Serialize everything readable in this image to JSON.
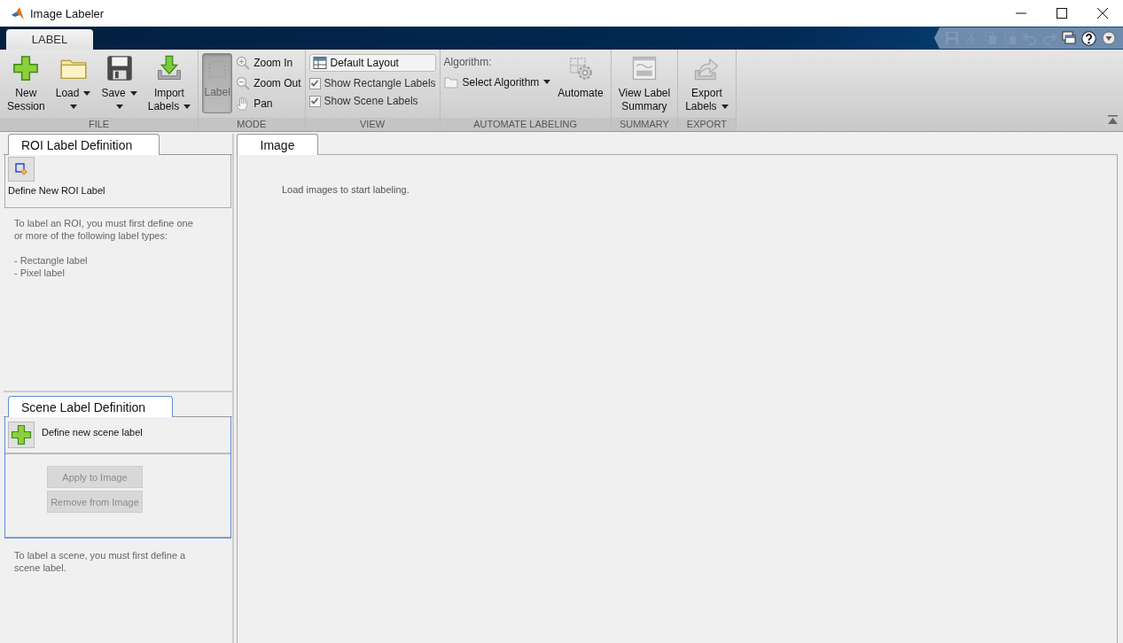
{
  "window": {
    "title": "Image Labeler"
  },
  "ribbon_tabs": [
    {
      "label": "LABEL",
      "selected": true
    }
  ],
  "quick_access": [
    {
      "kind": "save",
      "disabled": true
    },
    {
      "kind": "cut",
      "disabled": true
    },
    {
      "kind": "copy",
      "disabled": true
    },
    {
      "kind": "paste",
      "disabled": true
    },
    {
      "kind": "undo",
      "disabled": true
    },
    {
      "kind": "redo",
      "disabled": true
    },
    {
      "kind": "windows",
      "disabled": false
    },
    {
      "kind": "help",
      "disabled": false
    },
    {
      "kind": "more",
      "disabled": false
    }
  ],
  "sections": [
    {
      "title": "FILE",
      "columns": [
        [
          {
            "kind": "big",
            "lines": [
              "New",
              "Session"
            ],
            "dropdown": false
          }
        ],
        [
          {
            "kind": "big",
            "lines": [
              "Load"
            ],
            "dropdown": true
          }
        ],
        [
          {
            "kind": "big",
            "lines": [
              "Save"
            ],
            "dropdown": true
          }
        ],
        [
          {
            "kind": "big",
            "lines": [
              "Import",
              "Labels"
            ],
            "dropdown": true
          }
        ]
      ]
    },
    {
      "title": "MODE",
      "columns": [
        [
          {
            "kind": "toggle",
            "lines": [
              "Label"
            ],
            "selected": true
          }
        ],
        [
          {
            "kind": "small",
            "label": "Zoom In"
          },
          {
            "kind": "small",
            "label": "Zoom Out"
          },
          {
            "kind": "small",
            "label": "Pan"
          }
        ]
      ]
    },
    {
      "title": "VIEW",
      "columns": [
        [
          {
            "kind": "layout",
            "label": "Default Layout"
          },
          {
            "kind": "check",
            "label": "Show Rectangle Labels",
            "checked": true,
            "disabled": true
          },
          {
            "kind": "check",
            "label": "Show Scene Labels",
            "checked": true,
            "disabled": true
          }
        ]
      ]
    },
    {
      "title": "AUTOMATE LABELING",
      "columns": [
        [
          {
            "kind": "caption",
            "label": "Algorithm:"
          },
          {
            "kind": "select",
            "label": "Select Algorithm"
          }
        ],
        [
          {
            "kind": "big",
            "lines": [
              "Automate"
            ],
            "dropdown": false
          }
        ]
      ]
    },
    {
      "title": "SUMMARY",
      "columns": [
        [
          {
            "kind": "big",
            "lines": [
              "View Label",
              "Summary"
            ],
            "dropdown": false
          }
        ]
      ]
    },
    {
      "title": "EXPORT",
      "columns": [
        [
          {
            "kind": "big",
            "lines": [
              "Export",
              "Labels"
            ],
            "dropdown": true
          }
        ]
      ]
    }
  ],
  "roi_panel": {
    "tab": {
      "label": "ROI Label Definition",
      "selected": true
    },
    "define_button": {
      "label": "Define New ROI Label"
    },
    "help": "To label an ROI, you must first define one or more of the following label types:",
    "label_types": [
      "- Rectangle label",
      "- Pixel label"
    ]
  },
  "scene_panel": {
    "tab": {
      "label": "Scene Label Definition",
      "selected": true
    },
    "define_button": {
      "label": "Define new scene label"
    },
    "actions": [
      {
        "label": "Apply to Image",
        "disabled": true
      },
      {
        "label": "Remove from Image",
        "disabled": true
      }
    ],
    "help": "To label a scene, you must first define a scene label."
  },
  "document": {
    "tabs": [
      {
        "label": "Image",
        "selected": true
      }
    ],
    "message": "Load images to start labeling."
  }
}
